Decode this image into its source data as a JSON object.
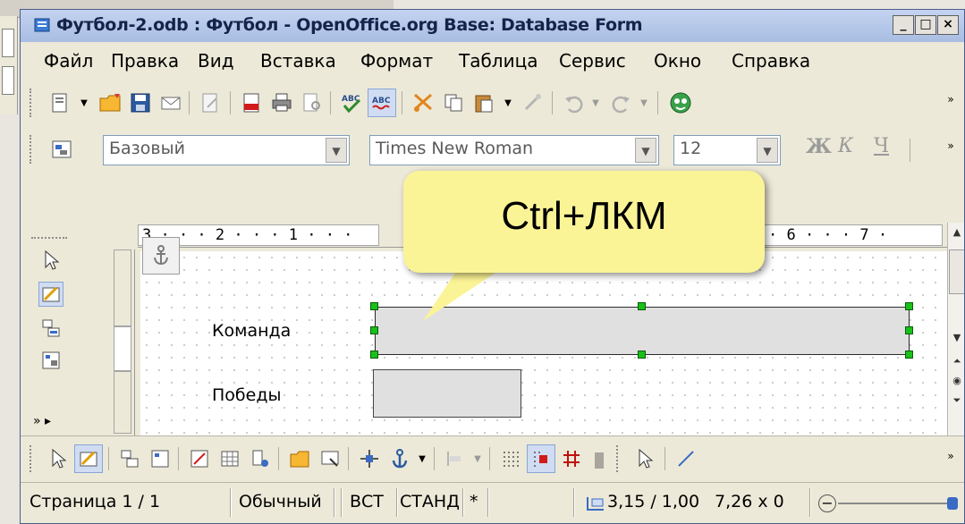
{
  "window": {
    "title": "Футбол-2.odb : Футбол - OpenOffice.org Base: Database Form"
  },
  "menu": [
    "Файл",
    "Правка",
    "Вид",
    "Вставка",
    "Формат",
    "Таблица",
    "Сервис",
    "Окно",
    "Справка"
  ],
  "format_bar": {
    "style": "Базовый",
    "font": "Times New Roman",
    "size": "12",
    "bold": "Ж",
    "italic": "К",
    "underline": "Ч"
  },
  "ruler": {
    "left_marks": "3 · · · 2 · · · 1 · · ·",
    "right_marks": "· 6 · · · 7 ·"
  },
  "form": {
    "labels": [
      "Команда",
      "Победы"
    ]
  },
  "callout": {
    "text": "Ctrl+ЛКМ"
  },
  "statusbar": {
    "page": "Страница  1 / 1",
    "style": "Обычный",
    "insert": "ВСТ",
    "mode": "СТАНД",
    "modified": "*",
    "position": "3,15 / 1,00",
    "size": "7,26 x 0"
  },
  "colors": {
    "handle": "#18c018",
    "callout": "#fbf496",
    "title_bg": "#b7c8ea"
  }
}
